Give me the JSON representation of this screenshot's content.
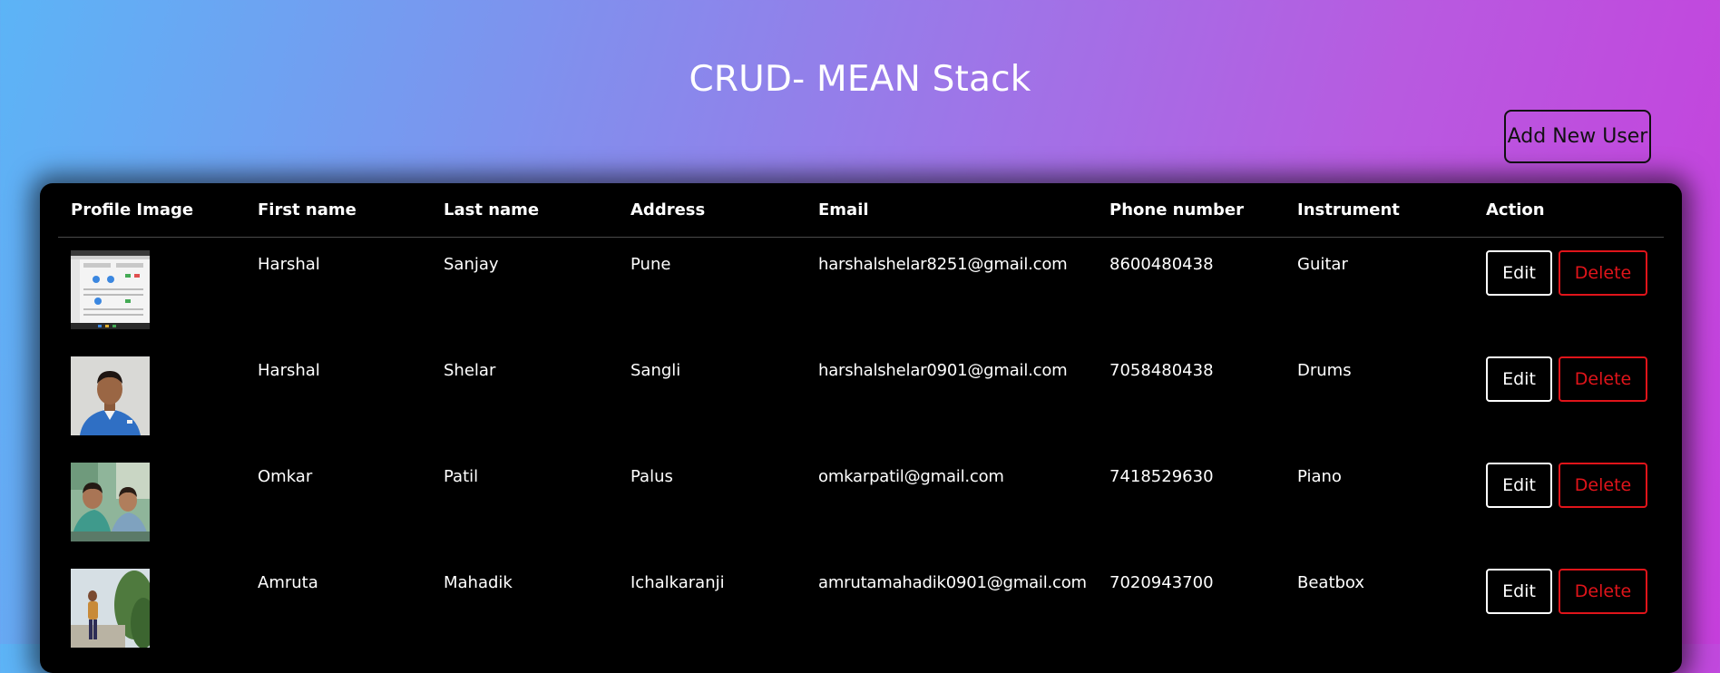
{
  "header": {
    "title": "CRUD- MEAN Stack",
    "add_button_label": "Add New User"
  },
  "table": {
    "columns": [
      "Profile Image",
      "First name",
      "Last name",
      "Address",
      "Email",
      "Phone number",
      "Instrument",
      "Action"
    ],
    "rows": [
      {
        "first_name": "Harshal",
        "last_name": "Sanjay",
        "address": "Pune",
        "email": "harshalshelar8251@gmail.com",
        "phone": "8600480438",
        "instrument": "Guitar",
        "edit_label": "Edit",
        "delete_label": "Delete"
      },
      {
        "first_name": "Harshal",
        "last_name": "Shelar",
        "address": "Sangli",
        "email": "harshalshelar0901@gmail.com",
        "phone": "7058480438",
        "instrument": "Drums",
        "edit_label": "Edit",
        "delete_label": "Delete"
      },
      {
        "first_name": "Omkar",
        "last_name": "Patil",
        "address": "Palus",
        "email": "omkarpatil@gmail.com",
        "phone": "7418529630",
        "instrument": "Piano",
        "edit_label": "Edit",
        "delete_label": "Delete"
      },
      {
        "first_name": "Amruta",
        "last_name": "Mahadik",
        "address": "Ichalkaranji",
        "email": "amrutamahadik0901@gmail.com",
        "phone": "7020943700",
        "instrument": "Beatbox",
        "edit_label": "Edit",
        "delete_label": "Delete"
      }
    ]
  },
  "colors": {
    "gradient_start": "#5cb4f6",
    "gradient_end": "#c63fdc",
    "table_background": "#000000",
    "delete_accent": "#e0141a",
    "text": "#ffffff"
  }
}
